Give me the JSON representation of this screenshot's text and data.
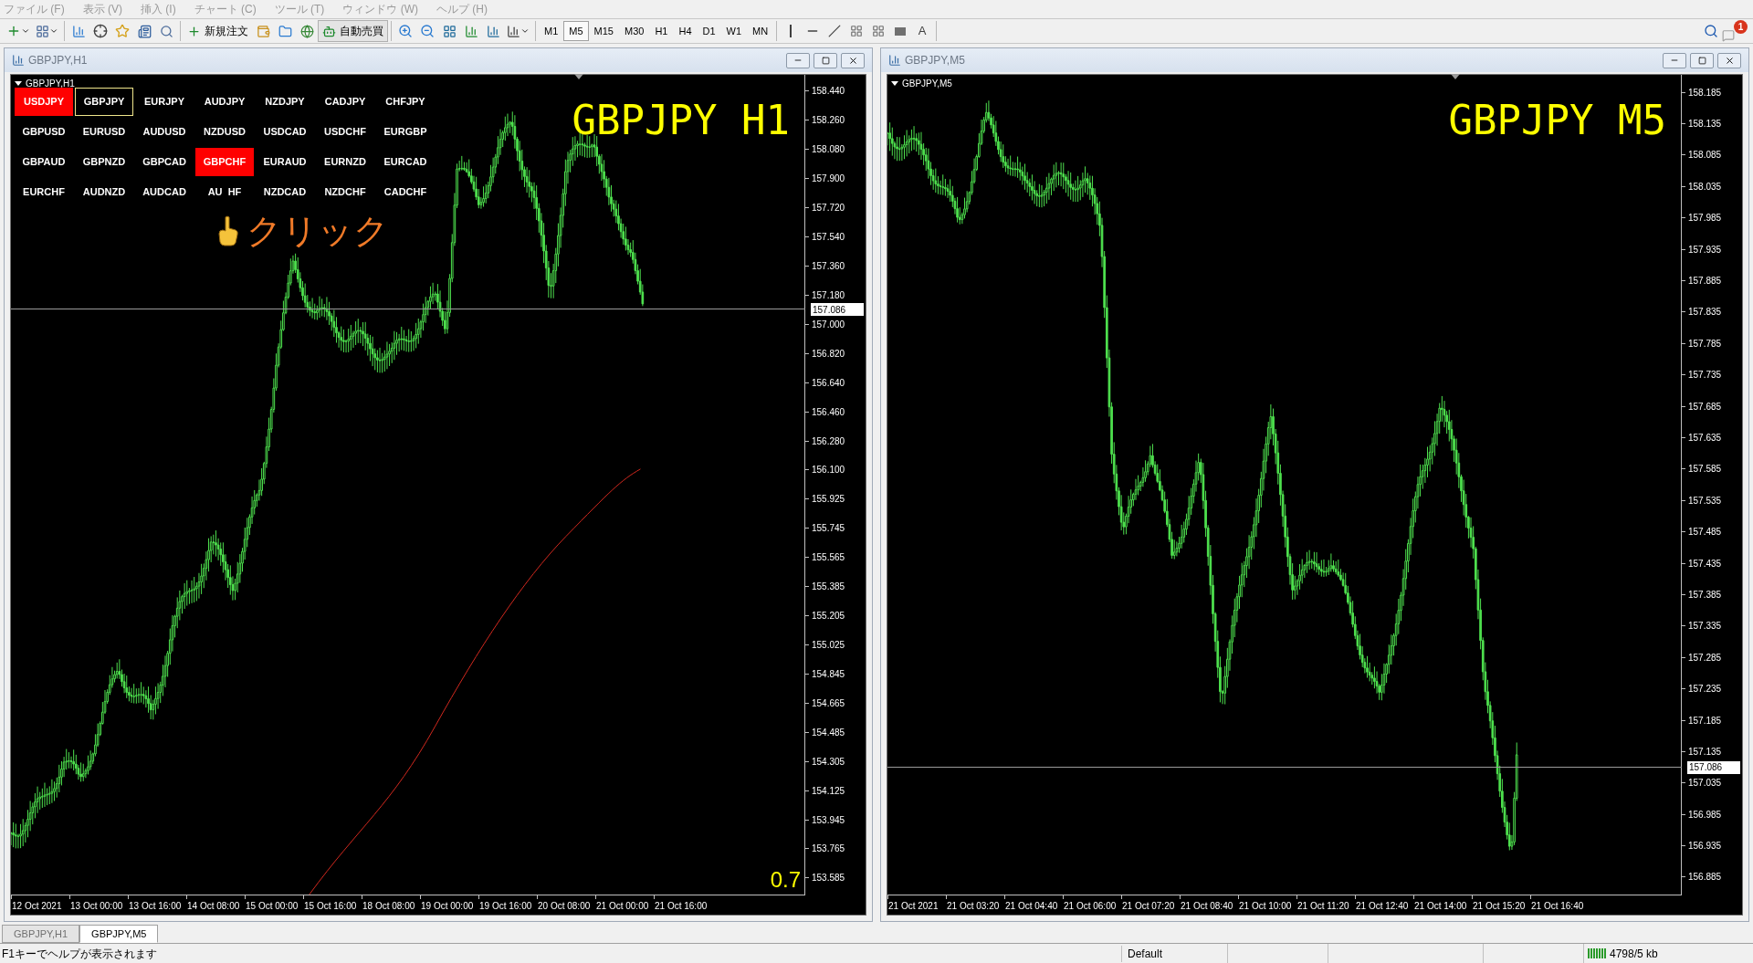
{
  "menu": [
    "ファイル (F)",
    "表示 (V)",
    "挿入 (I)",
    "チャート (C)",
    "ツール (T)",
    "ウィンドウ (W)",
    "ヘルプ (H)"
  ],
  "toolbar": {
    "new_order": "新規注文",
    "auto_trading": "自動売買",
    "timeframes": [
      {
        "label": "M1",
        "selected": false
      },
      {
        "label": "M5",
        "selected": true
      },
      {
        "label": "M15",
        "selected": false
      },
      {
        "label": "M30",
        "selected": false
      },
      {
        "label": "H1",
        "selected": false
      },
      {
        "label": "H4",
        "selected": false
      },
      {
        "label": "D1",
        "selected": false
      },
      {
        "label": "W1",
        "selected": false
      },
      {
        "label": "MN",
        "selected": false
      }
    ],
    "text_tool": "A",
    "notification_count": "1"
  },
  "charts": [
    {
      "title": "GBPJPY,H1",
      "label": "GBPJPY,H1",
      "big_label": "GBPJPY H1",
      "corner_value": "0.7",
      "symbol_buttons": [
        [
          {
            "label": "USDJPY",
            "highlighted": true,
            "current": false
          },
          {
            "label": "GBPJPY",
            "highlighted": false,
            "current": true
          },
          {
            "label": "EURJPY",
            "highlighted": false,
            "current": false
          },
          {
            "label": "AUDJPY",
            "highlighted": false,
            "current": false
          },
          {
            "label": "NZDJPY",
            "highlighted": false,
            "current": false
          },
          {
            "label": "CADJPY",
            "highlighted": false,
            "current": false
          },
          {
            "label": "CHFJPY",
            "highlighted": false,
            "current": false
          }
        ],
        [
          {
            "label": "GBPUSD",
            "highlighted": false,
            "current": false
          },
          {
            "label": "EURUSD",
            "highlighted": false,
            "current": false
          },
          {
            "label": "AUDUSD",
            "highlighted": false,
            "current": false
          },
          {
            "label": "NZDUSD",
            "highlighted": false,
            "current": false
          },
          {
            "label": "USDCAD",
            "highlighted": false,
            "current": false
          },
          {
            "label": "USDCHF",
            "highlighted": false,
            "current": false
          },
          {
            "label": "EURGBP",
            "highlighted": false,
            "current": false
          }
        ],
        [
          {
            "label": "GBPAUD",
            "highlighted": false,
            "current": false
          },
          {
            "label": "GBPNZD",
            "highlighted": false,
            "current": false
          },
          {
            "label": "GBPCAD",
            "highlighted": false,
            "current": false
          },
          {
            "label": "GBPCHF",
            "highlighted": true,
            "current": false
          },
          {
            "label": "EURAUD",
            "highlighted": false,
            "current": false
          },
          {
            "label": "EURNZD",
            "highlighted": false,
            "current": false
          },
          {
            "label": "EURCAD",
            "highlighted": false,
            "current": false
          }
        ],
        [
          {
            "label": "EURCHF",
            "highlighted": false,
            "current": false
          },
          {
            "label": "AUDNZD",
            "highlighted": false,
            "current": false
          },
          {
            "label": "AUDCAD",
            "highlighted": false,
            "current": false
          },
          {
            "label": "AU  HF",
            "highlighted": false,
            "current": false
          },
          {
            "label": "NZDCAD",
            "highlighted": false,
            "current": false
          },
          {
            "label": "NZDCHF",
            "highlighted": false,
            "current": false
          },
          {
            "label": "CADCHF",
            "highlighted": false,
            "current": false
          }
        ]
      ],
      "annotation": "クリック",
      "price_labels": [
        {
          "text": "158.440",
          "kind": "tick"
        },
        {
          "text": "158.260",
          "kind": "tick"
        },
        {
          "text": "158.080",
          "kind": "tick"
        },
        {
          "text": "157.900",
          "kind": "tick"
        },
        {
          "text": "157.720",
          "kind": "tick"
        },
        {
          "text": "157.540",
          "kind": "tick"
        },
        {
          "text": "157.360",
          "kind": "tick"
        },
        {
          "text": "157.180",
          "kind": "tick"
        },
        {
          "text": "157.086",
          "kind": "current"
        },
        {
          "text": "157.000",
          "kind": "tick"
        },
        {
          "text": "156.820",
          "kind": "tick"
        },
        {
          "text": "156.640",
          "kind": "tick"
        },
        {
          "text": "156.460",
          "kind": "tick"
        },
        {
          "text": "156.280",
          "kind": "tick"
        },
        {
          "text": "156.100",
          "kind": "tick"
        },
        {
          "text": "155.925",
          "kind": "tick"
        },
        {
          "text": "155.745",
          "kind": "tick"
        },
        {
          "text": "155.565",
          "kind": "tick"
        },
        {
          "text": "155.385",
          "kind": "tick"
        },
        {
          "text": "155.205",
          "kind": "tick"
        },
        {
          "text": "155.025",
          "kind": "tick"
        },
        {
          "text": "154.845",
          "kind": "tick"
        },
        {
          "text": "154.665",
          "kind": "tick"
        },
        {
          "text": "154.485",
          "kind": "tick"
        },
        {
          "text": "154.305",
          "kind": "tick"
        },
        {
          "text": "154.125",
          "kind": "tick"
        },
        {
          "text": "153.945",
          "kind": "tick"
        },
        {
          "text": "153.765",
          "kind": "tick"
        },
        {
          "text": "153.585",
          "kind": "tick"
        }
      ],
      "time_labels": [
        "12 Oct 2021",
        "13 Oct 00:00",
        "13 Oct 16:00",
        "14 Oct 08:00",
        "15 Oct 00:00",
        "15 Oct 16:00",
        "18 Oct 08:00",
        "19 Oct 00:00",
        "19 Oct 16:00",
        "20 Oct 08:00",
        "21 Oct 00:00",
        "21 Oct 16:00"
      ]
    },
    {
      "title": "GBPJPY,M5",
      "label": "GBPJPY,M5",
      "big_label": "GBPJPY M5",
      "price_labels": [
        {
          "text": "158.185",
          "kind": "tick"
        },
        {
          "text": "158.135",
          "kind": "tick"
        },
        {
          "text": "158.085",
          "kind": "tick"
        },
        {
          "text": "158.035",
          "kind": "tick"
        },
        {
          "text": "157.985",
          "kind": "tick"
        },
        {
          "text": "157.935",
          "kind": "tick"
        },
        {
          "text": "157.885",
          "kind": "tick"
        },
        {
          "text": "157.835",
          "kind": "tick"
        },
        {
          "text": "157.785",
          "kind": "tick"
        },
        {
          "text": "157.735",
          "kind": "tick"
        },
        {
          "text": "157.685",
          "kind": "tick"
        },
        {
          "text": "157.635",
          "kind": "tick"
        },
        {
          "text": "157.585",
          "kind": "tick"
        },
        {
          "text": "157.535",
          "kind": "tick"
        },
        {
          "text": "157.485",
          "kind": "tick"
        },
        {
          "text": "157.435",
          "kind": "tick"
        },
        {
          "text": "157.385",
          "kind": "tick"
        },
        {
          "text": "157.335",
          "kind": "tick"
        },
        {
          "text": "157.285",
          "kind": "tick"
        },
        {
          "text": "157.235",
          "kind": "tick"
        },
        {
          "text": "157.185",
          "kind": "tick"
        },
        {
          "text": "157.135",
          "kind": "tick"
        },
        {
          "text": "157.086",
          "kind": "current"
        },
        {
          "text": "157.035",
          "kind": "tick"
        },
        {
          "text": "156.985",
          "kind": "tick"
        },
        {
          "text": "156.935",
          "kind": "tick"
        },
        {
          "text": "156.885",
          "kind": "tick"
        }
      ],
      "time_labels": [
        "21 Oct 2021",
        "21 Oct 03:20",
        "21 Oct 04:40",
        "21 Oct 06:00",
        "21 Oct 07:20",
        "21 Oct 08:40",
        "21 Oct 10:00",
        "21 Oct 11:20",
        "21 Oct 12:40",
        "21 Oct 14:00",
        "21 Oct 15:20",
        "21 Oct 16:40"
      ]
    }
  ],
  "chart_tabs": [
    {
      "label": "GBPJPY,H1",
      "selected": false
    },
    {
      "label": "GBPJPY,M5",
      "selected": true
    }
  ],
  "status_bar": {
    "help": "F1キーでヘルプが表示されます",
    "profile": "Default",
    "traffic": "4798/5 kb"
  }
}
